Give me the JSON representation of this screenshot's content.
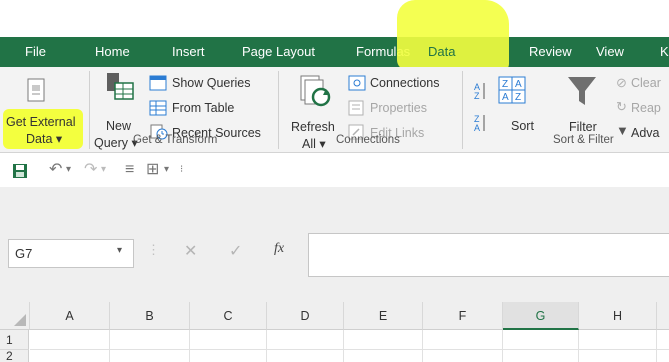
{
  "ribbon_tabs": [
    "File",
    "Home",
    "Insert",
    "Page Layout",
    "Formulas",
    "Data",
    "Review",
    "View",
    "K"
  ],
  "active_tab": "Data",
  "get_external": {
    "line1": "Get External",
    "line2": "Data",
    "arrow": "▾"
  },
  "get_transform": {
    "new_query_line1": "New",
    "new_query_line2": "Query",
    "arrow": "▾",
    "show_queries": "Show Queries",
    "from_table": "From Table",
    "recent_sources": "Recent Sources",
    "group_label": "Get & Transform"
  },
  "connections": {
    "refresh_line1": "Refresh",
    "refresh_line2": "All",
    "arrow": "▾",
    "connections": "Connections",
    "properties": "Properties",
    "edit_links": "Edit Links",
    "group_label": "Connections"
  },
  "sort_filter": {
    "sort": "Sort",
    "filter": "Filter",
    "clear": "Clear",
    "reapply": "Reap",
    "advanced": "Adva",
    "group_label": "Sort & Filter"
  },
  "formula_bar": {
    "name_box": "G7",
    "fx": "fx"
  },
  "columns": [
    "A",
    "B",
    "C",
    "D",
    "E",
    "F",
    "G",
    "H"
  ],
  "selected_column": "G",
  "rows": [
    "1",
    "2"
  ],
  "highlight_color": "#f3ff3f",
  "accent_color": "#217346"
}
